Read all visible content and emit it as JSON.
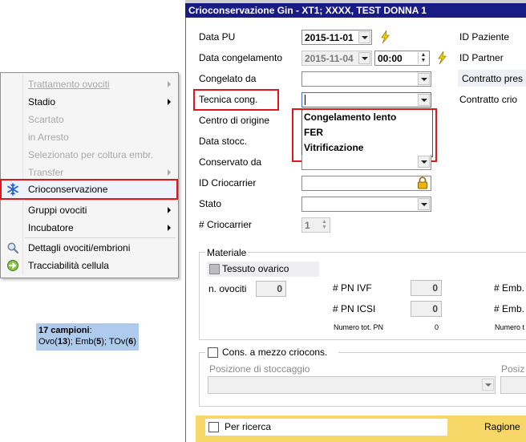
{
  "menu": {
    "items": [
      {
        "label": "Trattamento ovociti",
        "disabled": true,
        "submenu": true
      },
      {
        "label": "Stadio",
        "disabled": false,
        "submenu": true
      },
      {
        "label": "Scartato",
        "disabled": true,
        "submenu": false
      },
      {
        "label": "in Arresto",
        "disabled": true,
        "submenu": false
      },
      {
        "label": "Selezionato per coltura embr.",
        "disabled": true,
        "submenu": false
      },
      {
        "label": "Transfer",
        "disabled": true,
        "submenu": true
      },
      {
        "label": "Crioconservazione",
        "disabled": false,
        "submenu": false,
        "icon": "snowflake-icon",
        "highlighted": true
      },
      {
        "label": "Gruppi ovociti",
        "disabled": false,
        "submenu": true
      },
      {
        "label": "Incubatore",
        "disabled": false,
        "submenu": true
      },
      {
        "label": "Dettagli ovociti/embrioni",
        "disabled": false,
        "submenu": false,
        "icon": "magnifier-icon"
      },
      {
        "label": "Tracciabilità cellula",
        "disabled": false,
        "submenu": false,
        "icon": "trace-icon"
      }
    ]
  },
  "info": {
    "count": "17 campioni",
    "colon": ":",
    "ovo_label": "Ovo(",
    "ovo": "13",
    "emb_label": "); Emb(",
    "emb": "5",
    "tov_label": "); TOv(",
    "tov": "6",
    "close": ")"
  },
  "window": {
    "title": "Crioconservazione Gin  - XT1; XXXX, TEST DONNA 1",
    "data_pu_label": "Data PU",
    "data_pu_value": "2015-11-01",
    "data_congelamento_label": "Data congelamento",
    "data_congelamento_value": "2015-11-04",
    "time_value": "00:00",
    "congelato_da_label": "Congelato da",
    "tecnica_label": "Tecnica cong.",
    "tecnica_options": [
      "Congelamento lento",
      "FER",
      "Vitrificazione"
    ],
    "centro_label": "Centro di origine",
    "data_stocc_label": "Data stocc.",
    "conservato_label": "Conservato da",
    "id_criocarrier_label": "ID Criocarrier",
    "stato_label": "Stato",
    "n_criocarrier_label": "# Criocarrier",
    "n_criocarrier_value": "1",
    "id_paziente_label": "ID Paziente",
    "id_partner_label": "ID Partner",
    "contratto_pres_label": "Contratto pres",
    "contratto_crio_label": "Contratto crio",
    "materiale_label": "Materiale",
    "tessuto_label": "Tessuto ovarico",
    "n_ovociti_label": "n. ovociti",
    "n_ovociti_value": "0",
    "pn_ivf_label": "# PN IVF",
    "pn_ivf_value": "0",
    "pn_icsi_label": "# PN ICSI",
    "pn_icsi_value": "0",
    "numero_tot_pn_label": "Numero tot. PN",
    "numero_tot_pn_value": "0",
    "emb1_label": "# Emb.",
    "emb2_label": "# Emb.",
    "numero_tot_label": "Numero t",
    "cons_label": "Cons. a mezzo criocons.",
    "posizione_label": "Posizione di stoccaggio",
    "posiz_label": "Posiz",
    "per_ricerca_label": "Per ricerca",
    "ragione_label": "Ragione"
  },
  "colors": {
    "titlebar": "#1a1c86",
    "highlight": "#e0161b",
    "info_bg": "#aecbee",
    "bottom_bar": "#f7d768"
  }
}
